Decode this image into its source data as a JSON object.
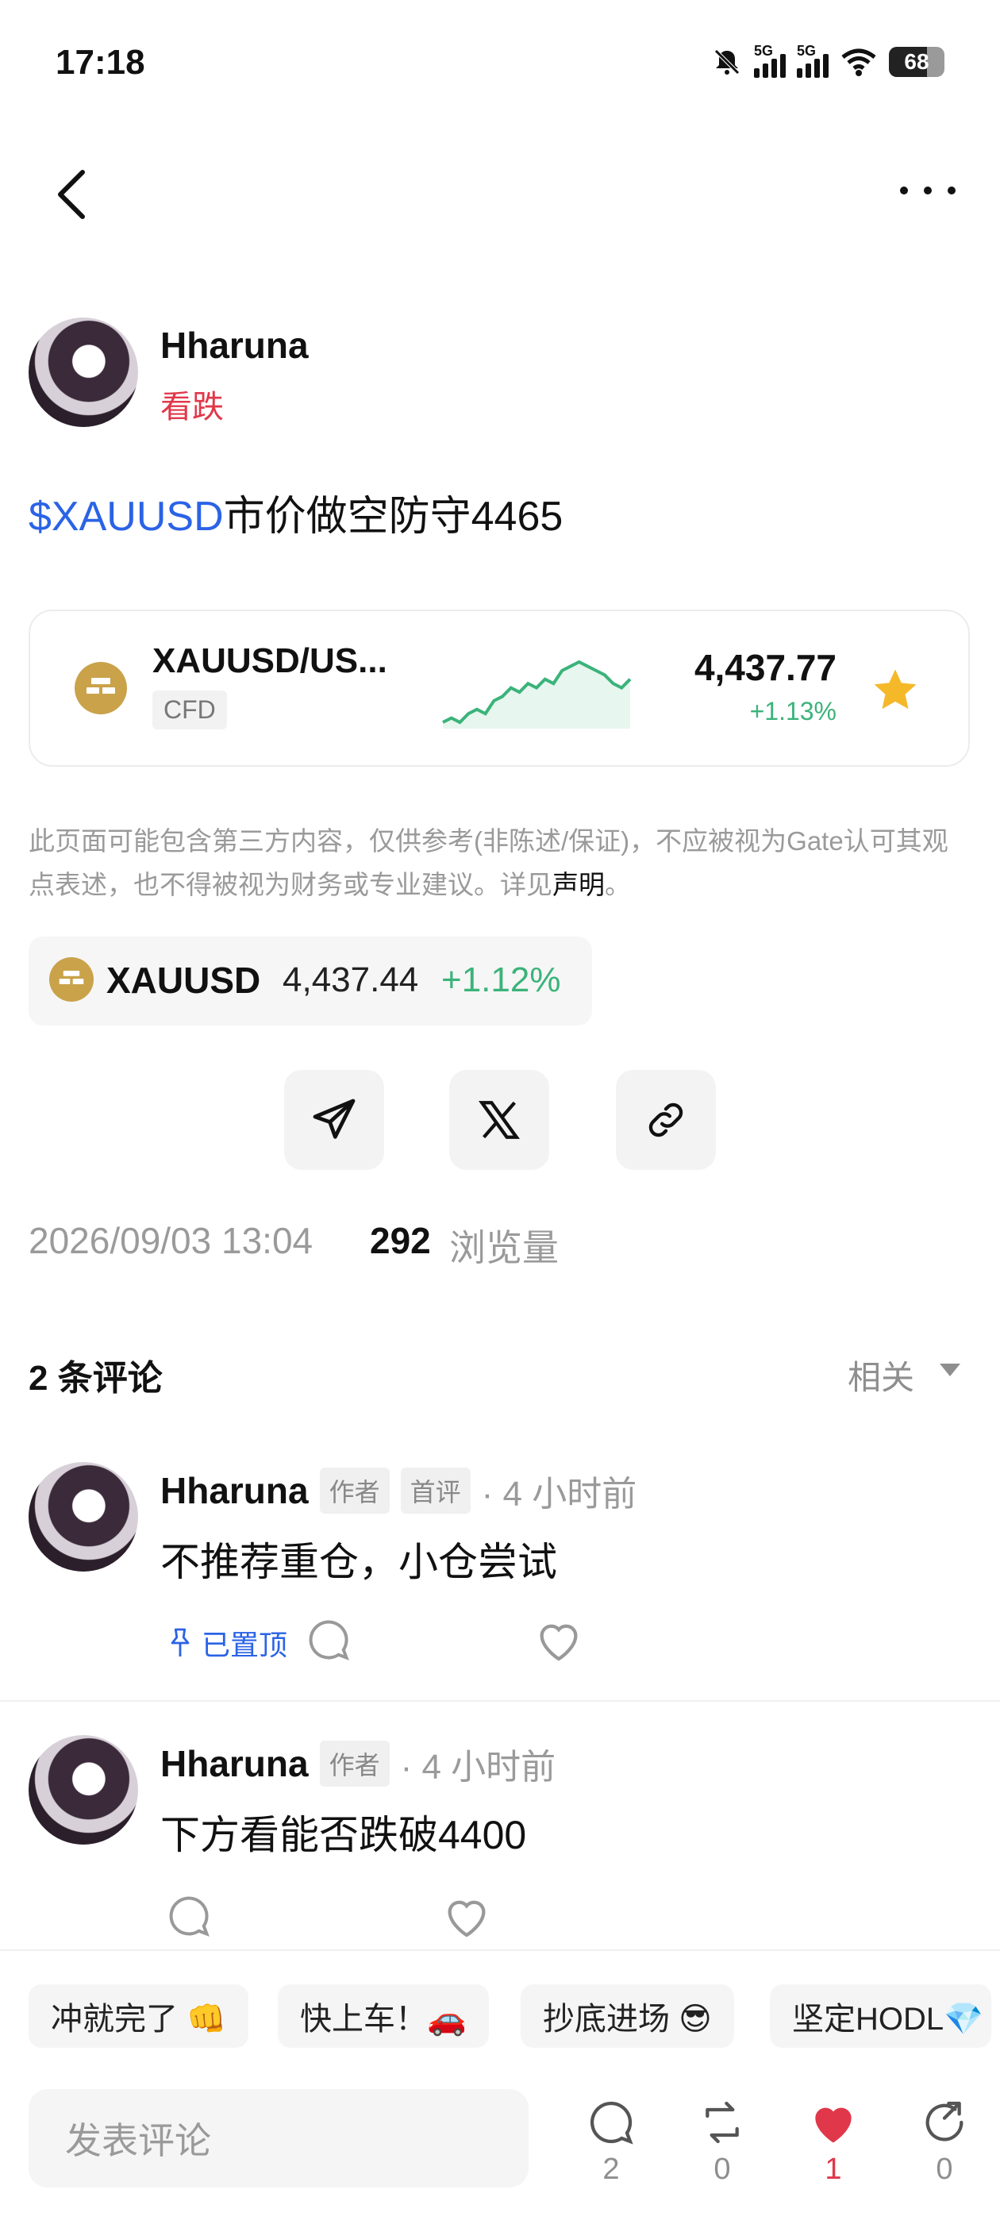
{
  "status_bar": {
    "time": "17:18",
    "network_1": "5G",
    "network_2": "5G",
    "battery": "68"
  },
  "post": {
    "author": "Hharuna",
    "sentiment": "看跌",
    "ticker_tag": "$XAUUSD",
    "text": "市价做空防守4465"
  },
  "ticker_card": {
    "pair": "XAUUSD/US...",
    "badge": "CFD",
    "price": "4,437.77",
    "change": "+1.13%"
  },
  "disclaimer": {
    "text": "此页面可能包含第三方内容，仅供参考(非陈述/保证)，不应被视为Gate认可其观点表述，也不得被视为财务或专业建议。详见",
    "link": "声明",
    "end": "。"
  },
  "mini_ticker": {
    "symbol": "XAUUSD",
    "price": "4,437.44",
    "change": "+1.12%"
  },
  "meta": {
    "date": "2026/09/03 13:04",
    "views": "292",
    "views_label": "浏览量"
  },
  "comments": {
    "count_label": "2 条评论",
    "sort_label": "相关",
    "items": [
      {
        "author": "Hharuna",
        "badges": [
          "作者",
          "首评"
        ],
        "time": "· 4 小时前",
        "text": "不推荐重仓，小仓尝试",
        "pinned": "已置顶"
      },
      {
        "author": "Hharuna",
        "badges": [
          "作者"
        ],
        "time": "· 4 小时前",
        "text": "下方看能否跌破4400"
      }
    ]
  },
  "quick_replies": [
    "冲就完了 👊",
    "快上车！🚗",
    "抄底进场 😎",
    "坚定HODL💎"
  ],
  "bottom": {
    "input_placeholder": "发表评论",
    "comment_count": "2",
    "repost_count": "0",
    "like_count": "1",
    "share_count": "0"
  },
  "colors": {
    "accent_blue": "#2b63e6",
    "up_green": "#3bb37a",
    "down_red": "#e0384a",
    "gold": "#c9a24a"
  },
  "chart_data": {
    "type": "line",
    "values": [
      3,
      4,
      3,
      5,
      6,
      5,
      8,
      9,
      11,
      10,
      12,
      11,
      13,
      12,
      15,
      16,
      17,
      16,
      15,
      14,
      12,
      11,
      13
    ]
  }
}
